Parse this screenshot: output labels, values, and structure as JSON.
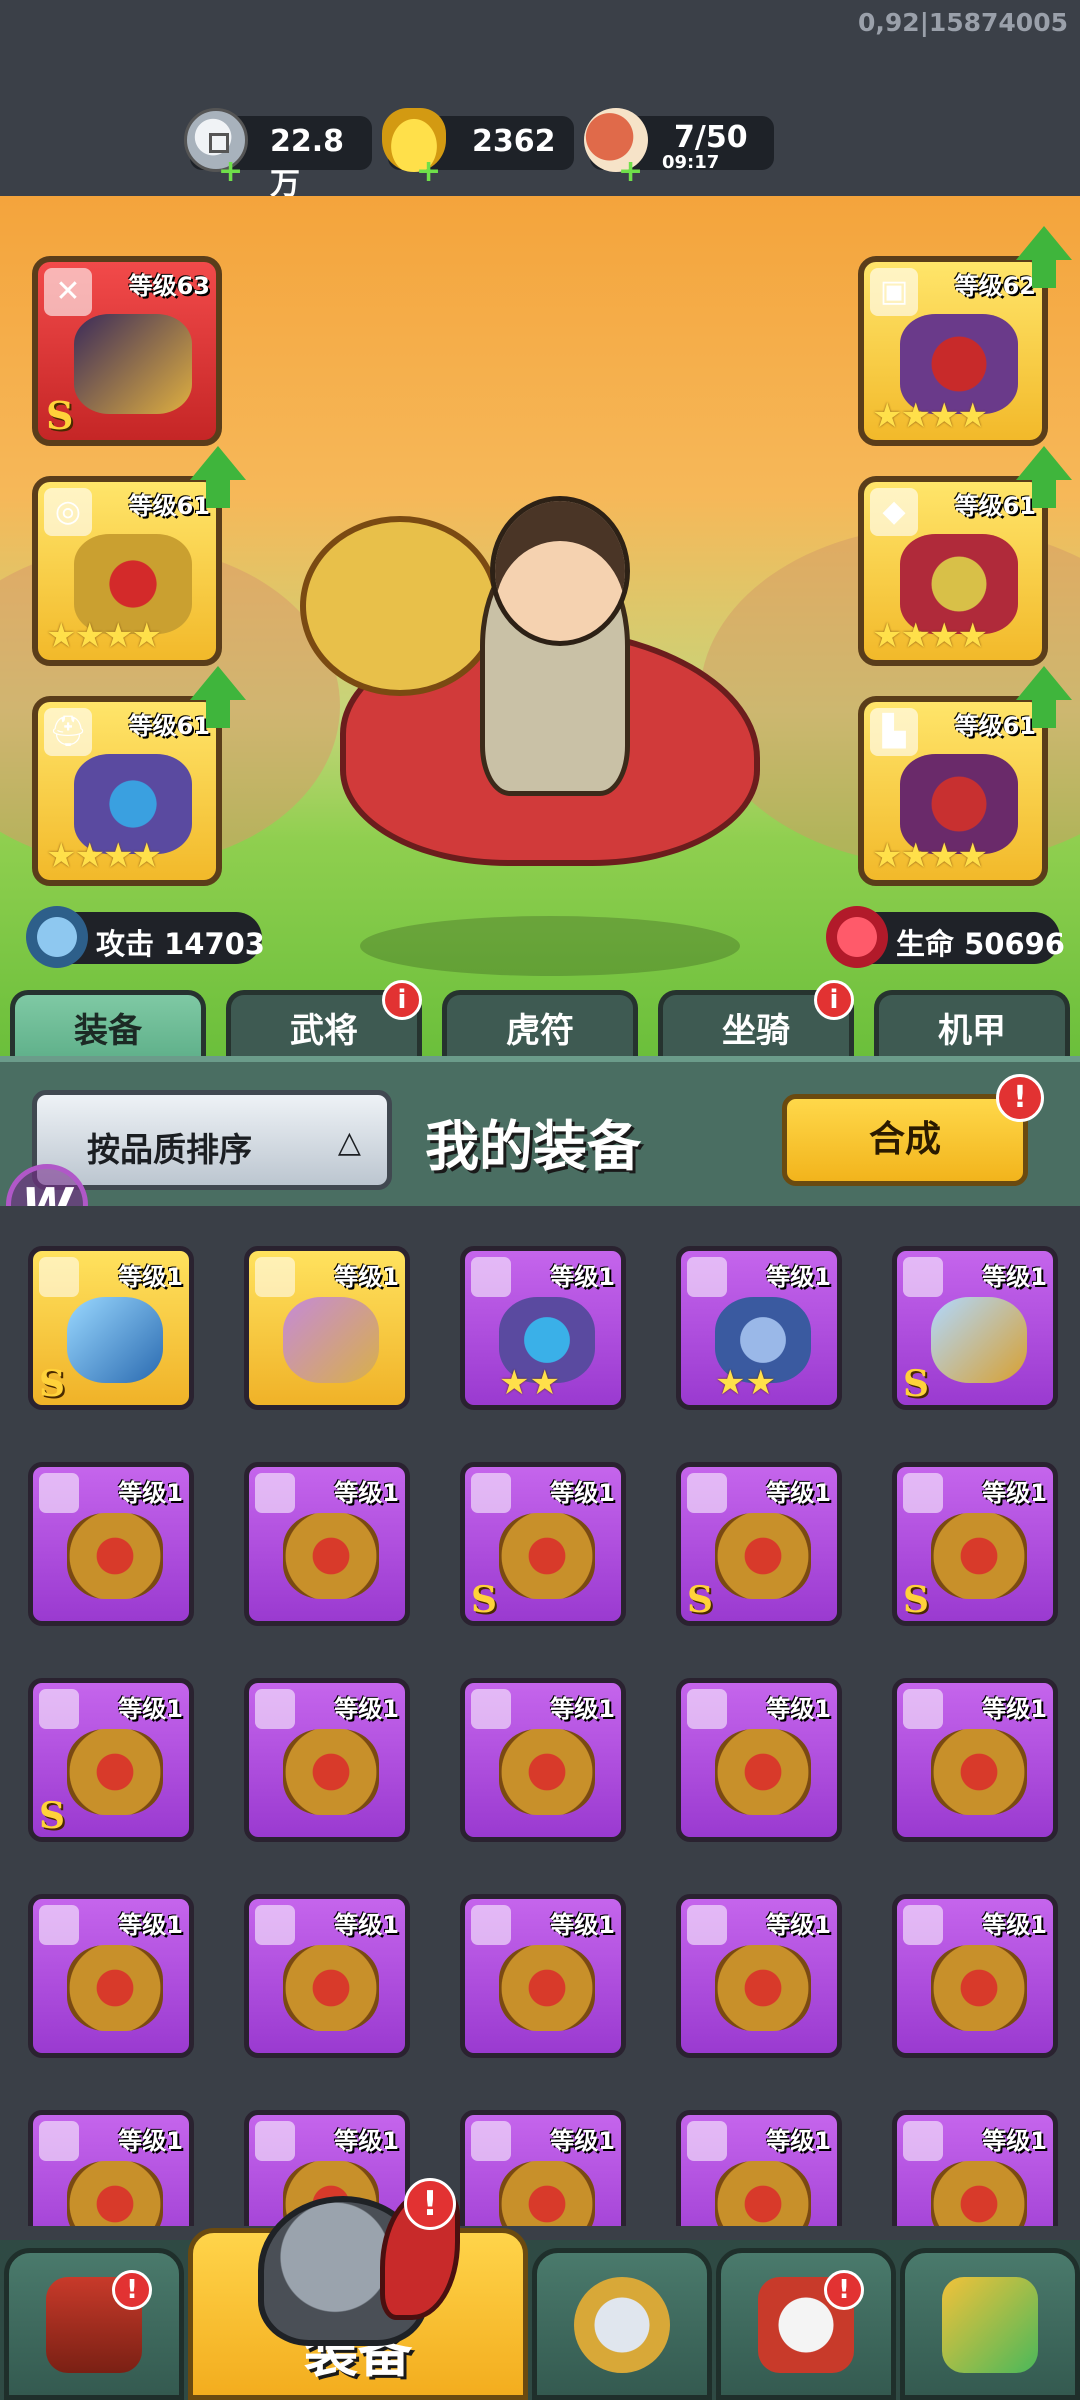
{
  "debug_text": "0,92|15874005",
  "resources": [
    {
      "name": "silver-coin",
      "value": "22.8万",
      "sub": ""
    },
    {
      "name": "gold-ingot",
      "value": "2362",
      "sub": ""
    },
    {
      "name": "meat-stamina",
      "value": "7/50",
      "sub": "09:17"
    }
  ],
  "hero_slots": {
    "left": [
      {
        "level": "等级63",
        "grade": "S",
        "stars": "",
        "quality": "red",
        "upgrade": false
      },
      {
        "level": "等级61",
        "grade": "",
        "stars": "★★★★",
        "quality": "gold",
        "upgrade": true
      },
      {
        "level": "等级61",
        "grade": "",
        "stars": "★★★★",
        "quality": "gold",
        "upgrade": true
      }
    ],
    "right": [
      {
        "level": "等级62",
        "grade": "",
        "stars": "★★★★",
        "quality": "gold",
        "upgrade": true
      },
      {
        "level": "等级61",
        "grade": "",
        "stars": "★★★★",
        "quality": "gold",
        "upgrade": true
      },
      {
        "level": "等级61",
        "grade": "",
        "stars": "★★★★",
        "quality": "gold",
        "upgrade": true
      }
    ]
  },
  "stats": {
    "attack": "攻击 14703",
    "life": "生命 50696"
  },
  "tabs": [
    {
      "label": "装备",
      "active": true,
      "alert": false
    },
    {
      "label": "武将",
      "active": false,
      "alert": true
    },
    {
      "label": "虎符",
      "active": false,
      "alert": false
    },
    {
      "label": "坐骑",
      "active": false,
      "alert": true
    },
    {
      "label": "机甲",
      "active": false,
      "alert": false
    }
  ],
  "panel": {
    "sort_label": "按品质排序",
    "title": "我的装备",
    "compose_label": "合成",
    "alert_mark": "!",
    "tab_alert_mark": "i"
  },
  "inventory": [
    [
      {
        "level": "等级1",
        "quality": "gold",
        "grade": "S",
        "stars": ""
      },
      {
        "level": "等级1",
        "quality": "gold",
        "grade": "",
        "stars": ""
      },
      {
        "level": "等级1",
        "quality": "purple",
        "grade": "",
        "stars": "★★"
      },
      {
        "level": "等级1",
        "quality": "purple",
        "grade": "",
        "stars": "★★"
      },
      {
        "level": "等级1",
        "quality": "purple",
        "grade": "S",
        "stars": ""
      }
    ],
    [
      {
        "level": "等级1",
        "quality": "purple",
        "grade": "",
        "stars": ""
      },
      {
        "level": "等级1",
        "quality": "purple",
        "grade": "",
        "stars": ""
      },
      {
        "level": "等级1",
        "quality": "purple",
        "grade": "S",
        "stars": ""
      },
      {
        "level": "等级1",
        "quality": "purple",
        "grade": "S",
        "stars": ""
      },
      {
        "level": "等级1",
        "quality": "purple",
        "grade": "S",
        "stars": ""
      }
    ],
    [
      {
        "level": "等级1",
        "quality": "purple",
        "grade": "S",
        "stars": ""
      },
      {
        "level": "等级1",
        "quality": "purple",
        "grade": "",
        "stars": ""
      },
      {
        "level": "等级1",
        "quality": "purple",
        "grade": "",
        "stars": ""
      },
      {
        "level": "等级1",
        "quality": "purple",
        "grade": "",
        "stars": ""
      },
      {
        "level": "等级1",
        "quality": "purple",
        "grade": "",
        "stars": ""
      }
    ],
    [
      {
        "level": "等级1",
        "quality": "purple",
        "grade": "",
        "stars": ""
      },
      {
        "level": "等级1",
        "quality": "purple",
        "grade": "",
        "stars": ""
      },
      {
        "level": "等级1",
        "quality": "purple",
        "grade": "",
        "stars": ""
      },
      {
        "level": "等级1",
        "quality": "purple",
        "grade": "",
        "stars": ""
      },
      {
        "level": "等级1",
        "quality": "purple",
        "grade": "",
        "stars": ""
      }
    ],
    [
      {
        "level": "等级1",
        "quality": "purple",
        "grade": "",
        "stars": ""
      },
      {
        "level": "等级1",
        "quality": "purple",
        "grade": "",
        "stars": ""
      },
      {
        "level": "等级1",
        "quality": "purple",
        "grade": "",
        "stars": ""
      },
      {
        "level": "等级1",
        "quality": "purple",
        "grade": "",
        "stars": ""
      },
      {
        "level": "等级1",
        "quality": "purple",
        "grade": "",
        "stars": ""
      }
    ]
  ],
  "bottom_nav": [
    {
      "name": "gate-icon",
      "label": "",
      "active": false,
      "alert": true
    },
    {
      "name": "helmet-icon",
      "label": "装备",
      "active": true,
      "alert": true
    },
    {
      "name": "battle-shield-icon",
      "label": "",
      "active": false,
      "alert": false
    },
    {
      "name": "rooster-icon",
      "label": "",
      "active": false,
      "alert": true
    },
    {
      "name": "fist-upgrade-icon",
      "label": "",
      "active": false,
      "alert": false
    }
  ],
  "colors": {
    "gold_quality": "#f2b92a",
    "purple_quality": "#b04fe0",
    "red_quality": "#d83030",
    "alert_red": "#e23232",
    "upgrade_green": "#3fb53c"
  }
}
